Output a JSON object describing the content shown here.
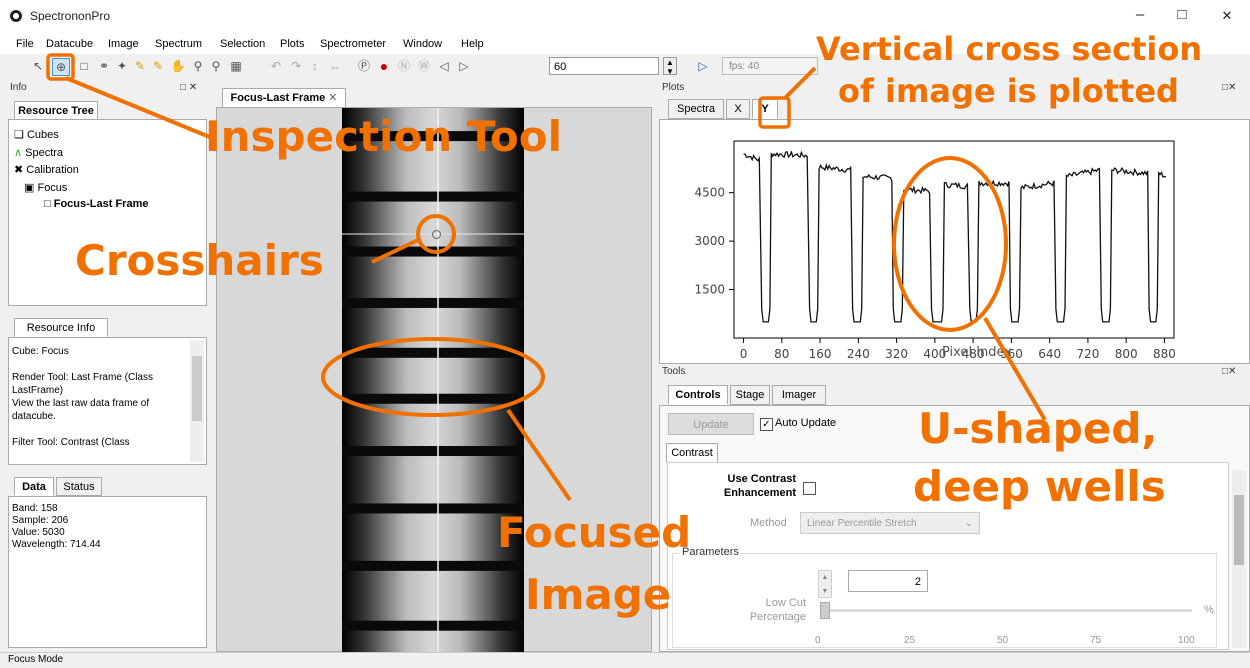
{
  "window": {
    "title": "SpectrononPro",
    "minimize": "–",
    "maximize": "□",
    "close": "✕"
  },
  "menu": [
    "File",
    "Datacube",
    "Image",
    "Spectrum",
    "Selection",
    "Plots",
    "Spectrometer",
    "Window",
    "Help"
  ],
  "toolbar": {
    "frame_value": "60",
    "fps_label": "fps: 40",
    "icons": [
      "select-arrow-icon",
      "inspection-crosshair-icon",
      "rectangle-select-icon",
      "lasso-icon",
      "magic-wand-icon",
      "brush-icon",
      "pan-hand-icon",
      "zoom-in-icon",
      "zoom-out-icon",
      "zoom-fit-icon",
      "undo-icon",
      "redo-icon",
      "flip-vertical-icon",
      "flip-horizontal-icon",
      "record-icon",
      "stop-icon",
      "dark-icon",
      "white-icon",
      "prev-icon",
      "next-icon",
      "play-icon"
    ]
  },
  "info_panel": {
    "title": "Info",
    "tab": "Resource Tree",
    "tree": [
      {
        "label": "Cubes",
        "icon": "cube-icon"
      },
      {
        "label": "Spectra",
        "icon": "spectra-icon"
      },
      {
        "label": "Calibration",
        "icon": "calibration-icon"
      },
      {
        "label": "Focus",
        "icon": "focus-cube-icon"
      },
      {
        "label": "Focus-Last Frame",
        "icon": "frame-icon"
      }
    ],
    "resource_info_tab": "Resource Info",
    "resource_info_lines": [
      "Cube: Focus",
      "",
      "Render Tool:  Last Frame (Class",
      "LastFrame)",
      " View the last raw data frame of",
      "datacube.",
      "",
      "Filter Tool: Contrast (Class"
    ],
    "data_tabs": [
      "Data",
      "Status"
    ],
    "data_lines": [
      "Band: 158",
      "Sample: 206",
      "Value: 5030",
      "Wavelength: 714.44"
    ]
  },
  "image_panel": {
    "tab": "Focus-Last Frame",
    "tab_close": "✕"
  },
  "plots_panel": {
    "title": "Plots",
    "tabs": [
      "Spectra",
      "X",
      "Y"
    ]
  },
  "chart_data": {
    "type": "line",
    "xlabel": "Pixel Index",
    "x_ticks": [
      "0",
      "80",
      "160",
      "240",
      "320",
      "400",
      "480",
      "560",
      "640",
      "720",
      "800",
      "880"
    ],
    "y_ticks": [
      "1500",
      "3000",
      "4500"
    ],
    "xlim": [
      -20,
      900
    ],
    "ylim": [
      0,
      6100
    ],
    "wells": [
      {
        "start": 35,
        "end": 58,
        "bottom": 500,
        "top_after": 5700
      },
      {
        "start": 135,
        "end": 158,
        "bottom": 500,
        "top_after": 5200
      },
      {
        "start": 225,
        "end": 250,
        "bottom": 500,
        "top_after": 4800
      },
      {
        "start": 310,
        "end": 335,
        "bottom": 500,
        "top_after": 4600
      },
      {
        "start": 390,
        "end": 420,
        "bottom": 500,
        "top_after": 4700
      },
      {
        "start": 470,
        "end": 492,
        "bottom": 500,
        "top_after": 4800
      },
      {
        "start": 555,
        "end": 580,
        "bottom": 500,
        "top_after": 4700
      },
      {
        "start": 650,
        "end": 675,
        "bottom": 500,
        "top_after": 5000
      },
      {
        "start": 745,
        "end": 770,
        "bottom": 500,
        "top_after": 5200
      },
      {
        "start": 845,
        "end": 868,
        "bottom": 500,
        "top_after": 5100
      }
    ],
    "plateaus": [
      {
        "x0": 0,
        "x1": 35,
        "y0": 5700,
        "y1": 5500
      },
      {
        "x0": 58,
        "x1": 135,
        "y0": 5700,
        "y1": 5650
      },
      {
        "x0": 158,
        "x1": 225,
        "y0": 5300,
        "y1": 5200
      },
      {
        "x0": 250,
        "x1": 310,
        "y0": 5000,
        "y1": 4950
      },
      {
        "x0": 335,
        "x1": 390,
        "y0": 4600,
        "y1": 4550
      },
      {
        "x0": 420,
        "x1": 470,
        "y0": 4750,
        "y1": 4700
      },
      {
        "x0": 492,
        "x1": 555,
        "y0": 4800,
        "y1": 4800
      },
      {
        "x0": 580,
        "x1": 650,
        "y0": 4650,
        "y1": 4800
      },
      {
        "x0": 675,
        "x1": 745,
        "y0": 5000,
        "y1": 5200
      },
      {
        "x0": 770,
        "x1": 845,
        "y0": 5200,
        "y1": 5100
      },
      {
        "x0": 868,
        "x1": 885,
        "y0": 5100,
        "y1": 5000
      }
    ]
  },
  "tools_panel": {
    "title": "Tools",
    "tabs": [
      "Controls",
      "Stage",
      "Imager"
    ],
    "update_button": "Update",
    "auto_update_label": "Auto Update",
    "contrast_tab": "Contrast",
    "use_contrast_label_1": "Use Contrast",
    "use_contrast_label_2": "Enhancement",
    "method_label": "Method",
    "method_value": "Linear Percentile Stretch",
    "parameters_label": "Parameters",
    "low_cut_value": "2",
    "low_cut_label_1": "Low Cut",
    "low_cut_label_2": "Percentage",
    "percent_symbol": "%",
    "slider_ticks": [
      "0",
      "25",
      "50",
      "75",
      "100"
    ]
  },
  "status_bar": {
    "text": "Focus Mode"
  },
  "annotations": {
    "inspection_tool": "Inspection Tool",
    "crosshairs": "Crosshairs",
    "focused_image_1": "Focused",
    "focused_image_2": "Image",
    "vertical_cross_1": "Vertical cross section",
    "vertical_cross_2": "of image is plotted",
    "u_shaped_1": "U-shaped,",
    "u_shaped_2": "deep wells",
    "accent_color": "#f07000"
  }
}
